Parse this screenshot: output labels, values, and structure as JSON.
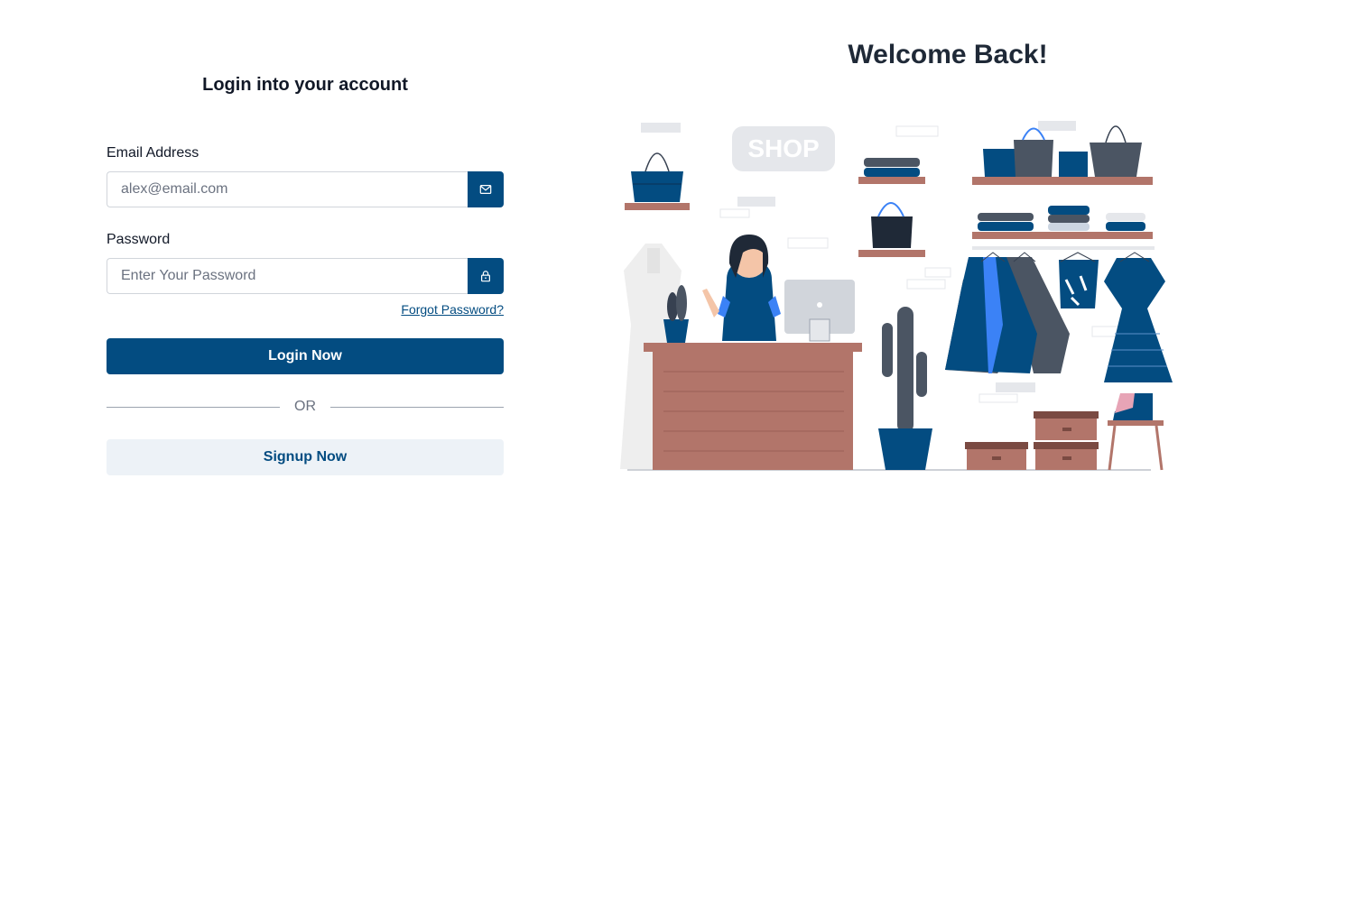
{
  "login": {
    "title": "Login into your account",
    "email_label": "Email Address",
    "email_placeholder": "alex@email.com",
    "password_label": "Password",
    "password_placeholder": "Enter Your Password",
    "forgot_password": "Forgot Password?",
    "login_button": "Login Now",
    "divider_text": "OR",
    "signup_button": "Signup Now"
  },
  "welcome": {
    "title": "Welcome Back!"
  },
  "illustration": {
    "sign_text": "SHOP"
  },
  "icons": {
    "email": "mail-icon",
    "password": "lock-icon"
  },
  "colors": {
    "brand": "#034c81",
    "secondary_button_bg": "#edf2f7"
  }
}
